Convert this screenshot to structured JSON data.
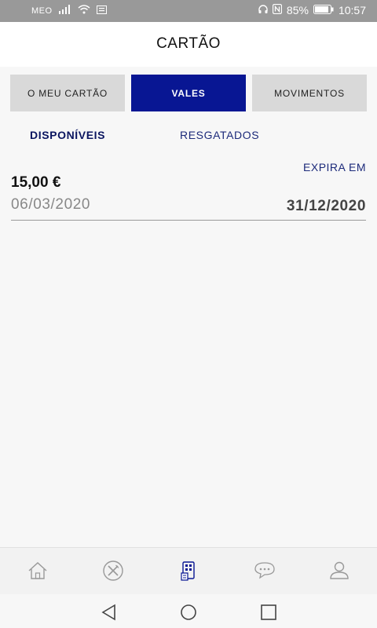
{
  "status_bar": {
    "carrier": "MEO",
    "battery": "85%",
    "time": "10:57"
  },
  "header": {
    "title": "CARTÃO"
  },
  "tabs": [
    {
      "label": "O MEU CARTÃO",
      "active": false
    },
    {
      "label": "VALES",
      "active": true
    },
    {
      "label": "MOVIMENTOS",
      "active": false
    }
  ],
  "subtabs": [
    {
      "label": "DISPONÍVEIS",
      "active": true
    },
    {
      "label": "RESGATADOS",
      "active": false
    }
  ],
  "voucher": {
    "expires_label": "EXPIRA EM",
    "amount": "15,00 €",
    "issued_date": "06/03/2020",
    "expiry_date": "31/12/2020"
  },
  "bottom_nav": [
    {
      "icon": "home-icon"
    },
    {
      "icon": "fork-knife-icon"
    },
    {
      "icon": "card-qr-icon",
      "active": true
    },
    {
      "icon": "chat-icon"
    },
    {
      "icon": "user-icon"
    }
  ],
  "colors": {
    "accent": "#081693",
    "status_bar": "#999999",
    "tab_inactive": "#d9d9d9"
  }
}
